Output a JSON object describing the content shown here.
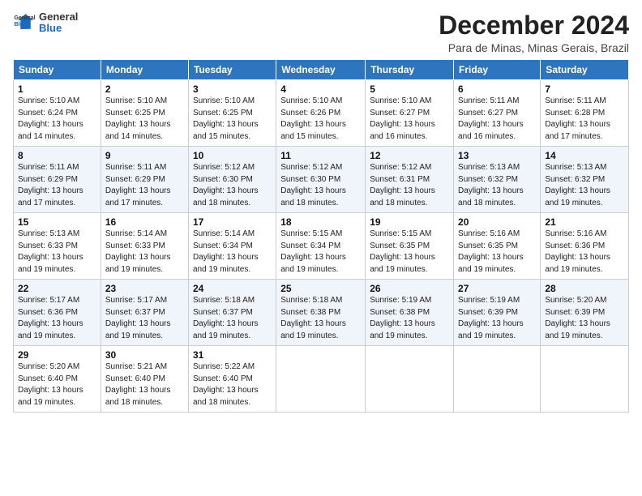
{
  "logo": {
    "line1": "General",
    "line2": "Blue"
  },
  "title": "December 2024",
  "subtitle": "Para de Minas, Minas Gerais, Brazil",
  "headers": [
    "Sunday",
    "Monday",
    "Tuesday",
    "Wednesday",
    "Thursday",
    "Friday",
    "Saturday"
  ],
  "weeks": [
    [
      {
        "day": "1",
        "sunrise": "5:10 AM",
        "sunset": "6:24 PM",
        "daylight": "13 hours and 14 minutes."
      },
      {
        "day": "2",
        "sunrise": "5:10 AM",
        "sunset": "6:25 PM",
        "daylight": "13 hours and 14 minutes."
      },
      {
        "day": "3",
        "sunrise": "5:10 AM",
        "sunset": "6:25 PM",
        "daylight": "13 hours and 15 minutes."
      },
      {
        "day": "4",
        "sunrise": "5:10 AM",
        "sunset": "6:26 PM",
        "daylight": "13 hours and 15 minutes."
      },
      {
        "day": "5",
        "sunrise": "5:10 AM",
        "sunset": "6:27 PM",
        "daylight": "13 hours and 16 minutes."
      },
      {
        "day": "6",
        "sunrise": "5:11 AM",
        "sunset": "6:27 PM",
        "daylight": "13 hours and 16 minutes."
      },
      {
        "day": "7",
        "sunrise": "5:11 AM",
        "sunset": "6:28 PM",
        "daylight": "13 hours and 17 minutes."
      }
    ],
    [
      {
        "day": "8",
        "sunrise": "5:11 AM",
        "sunset": "6:29 PM",
        "daylight": "13 hours and 17 minutes."
      },
      {
        "day": "9",
        "sunrise": "5:11 AM",
        "sunset": "6:29 PM",
        "daylight": "13 hours and 17 minutes."
      },
      {
        "day": "10",
        "sunrise": "5:12 AM",
        "sunset": "6:30 PM",
        "daylight": "13 hours and 18 minutes."
      },
      {
        "day": "11",
        "sunrise": "5:12 AM",
        "sunset": "6:30 PM",
        "daylight": "13 hours and 18 minutes."
      },
      {
        "day": "12",
        "sunrise": "5:12 AM",
        "sunset": "6:31 PM",
        "daylight": "13 hours and 18 minutes."
      },
      {
        "day": "13",
        "sunrise": "5:13 AM",
        "sunset": "6:32 PM",
        "daylight": "13 hours and 18 minutes."
      },
      {
        "day": "14",
        "sunrise": "5:13 AM",
        "sunset": "6:32 PM",
        "daylight": "13 hours and 19 minutes."
      }
    ],
    [
      {
        "day": "15",
        "sunrise": "5:13 AM",
        "sunset": "6:33 PM",
        "daylight": "13 hours and 19 minutes."
      },
      {
        "day": "16",
        "sunrise": "5:14 AM",
        "sunset": "6:33 PM",
        "daylight": "13 hours and 19 minutes."
      },
      {
        "day": "17",
        "sunrise": "5:14 AM",
        "sunset": "6:34 PM",
        "daylight": "13 hours and 19 minutes."
      },
      {
        "day": "18",
        "sunrise": "5:15 AM",
        "sunset": "6:34 PM",
        "daylight": "13 hours and 19 minutes."
      },
      {
        "day": "19",
        "sunrise": "5:15 AM",
        "sunset": "6:35 PM",
        "daylight": "13 hours and 19 minutes."
      },
      {
        "day": "20",
        "sunrise": "5:16 AM",
        "sunset": "6:35 PM",
        "daylight": "13 hours and 19 minutes."
      },
      {
        "day": "21",
        "sunrise": "5:16 AM",
        "sunset": "6:36 PM",
        "daylight": "13 hours and 19 minutes."
      }
    ],
    [
      {
        "day": "22",
        "sunrise": "5:17 AM",
        "sunset": "6:36 PM",
        "daylight": "13 hours and 19 minutes."
      },
      {
        "day": "23",
        "sunrise": "5:17 AM",
        "sunset": "6:37 PM",
        "daylight": "13 hours and 19 minutes."
      },
      {
        "day": "24",
        "sunrise": "5:18 AM",
        "sunset": "6:37 PM",
        "daylight": "13 hours and 19 minutes."
      },
      {
        "day": "25",
        "sunrise": "5:18 AM",
        "sunset": "6:38 PM",
        "daylight": "13 hours and 19 minutes."
      },
      {
        "day": "26",
        "sunrise": "5:19 AM",
        "sunset": "6:38 PM",
        "daylight": "13 hours and 19 minutes."
      },
      {
        "day": "27",
        "sunrise": "5:19 AM",
        "sunset": "6:39 PM",
        "daylight": "13 hours and 19 minutes."
      },
      {
        "day": "28",
        "sunrise": "5:20 AM",
        "sunset": "6:39 PM",
        "daylight": "13 hours and 19 minutes."
      }
    ],
    [
      {
        "day": "29",
        "sunrise": "5:20 AM",
        "sunset": "6:40 PM",
        "daylight": "13 hours and 19 minutes."
      },
      {
        "day": "30",
        "sunrise": "5:21 AM",
        "sunset": "6:40 PM",
        "daylight": "13 hours and 18 minutes."
      },
      {
        "day": "31",
        "sunrise": "5:22 AM",
        "sunset": "6:40 PM",
        "daylight": "13 hours and 18 minutes."
      },
      null,
      null,
      null,
      null
    ]
  ],
  "labels": {
    "sunrise": "Sunrise:",
    "sunset": "Sunset:",
    "daylight": "Daylight:"
  }
}
